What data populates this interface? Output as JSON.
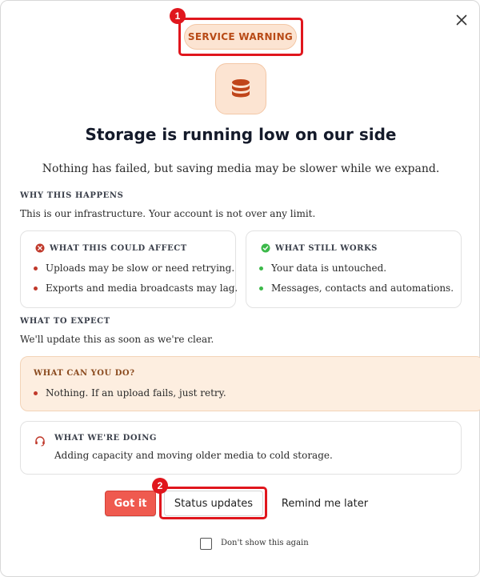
{
  "badge": {
    "label": "SERVICE WARNING"
  },
  "title": "Storage is running low on our side",
  "subtitle": "Nothing has failed, but saving media may be slower while we expand.",
  "why": {
    "label": "WHY THIS HAPPENS",
    "text": "This is our infrastructure. Your account is not over any limit."
  },
  "affect_card": {
    "heading": "WHAT THIS COULD AFFECT",
    "icon": "x-circle-icon",
    "items": [
      "Uploads may be slow or need retrying.",
      "Exports and media broadcasts may lag."
    ]
  },
  "works_card": {
    "heading": "WHAT STILL WORKS",
    "icon": "check-circle-icon",
    "items": [
      "Your data is untouched.",
      "Messages, contacts and automations."
    ]
  },
  "expect": {
    "label": "WHAT TO EXPECT",
    "text": "We'll update this as soon as we're clear."
  },
  "can_do": {
    "heading": "WHAT CAN YOU DO?",
    "item": "Nothing. If an upload fails, just retry."
  },
  "doing": {
    "heading": "WHAT WE'RE DOING",
    "icon": "headset-icon",
    "text": "Adding capacity and moving older media to cold storage."
  },
  "actions": {
    "primary": "Got it",
    "secondary": "Status updates",
    "tertiary": "Remind me later"
  },
  "dont_show": {
    "label": "Don't show this again",
    "checked": false
  },
  "annotations": [
    "1",
    "2"
  ],
  "colors": {
    "accent": "#ef5a4f",
    "warning_bg": "#fce4d2",
    "warning_text": "#b84a16",
    "bullet_red": "#c0392b",
    "bullet_green": "#3cb94a",
    "annotation_red": "#e0161d"
  }
}
